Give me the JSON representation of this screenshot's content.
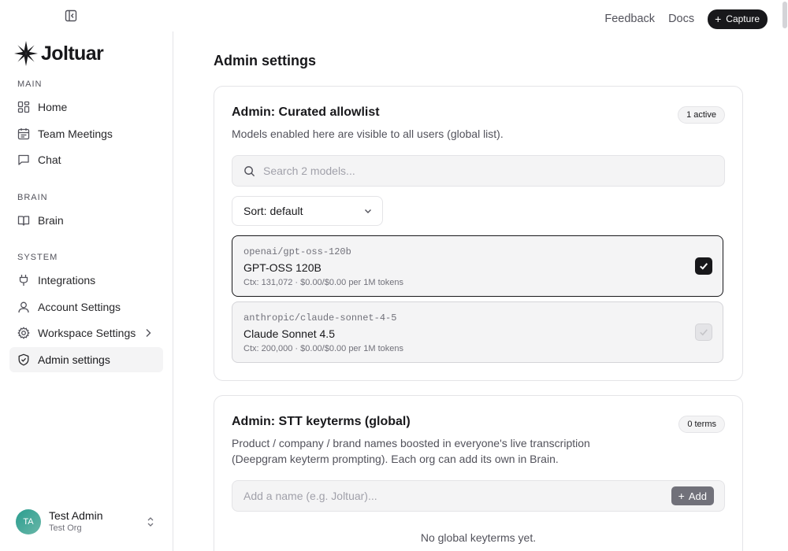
{
  "topbar": {
    "feedback": "Feedback",
    "docs": "Docs",
    "capture": "Capture"
  },
  "brand": {
    "name": "Joltuar"
  },
  "sidebar": {
    "sections": {
      "main": "MAIN",
      "brain": "BRAIN",
      "system": "SYSTEM"
    },
    "items": [
      {
        "label": "Home",
        "icon": "grid-icon"
      },
      {
        "label": "Team Meetings",
        "icon": "calendar-icon"
      },
      {
        "label": "Chat",
        "icon": "chat-bubble-icon"
      },
      {
        "label": "Brain",
        "icon": "book-icon"
      },
      {
        "label": "Integrations",
        "icon": "plug-icon"
      },
      {
        "label": "Account Settings",
        "icon": "user-icon"
      },
      {
        "label": "Workspace Settings",
        "icon": "gear-icon"
      },
      {
        "label": "Admin settings",
        "icon": "shield-check-icon"
      }
    ],
    "active": "Admin settings"
  },
  "user": {
    "initials": "TA",
    "name": "Test Admin",
    "org": "Test Org"
  },
  "page": {
    "title": "Admin settings"
  },
  "allowlist": {
    "title": "Admin: Curated allowlist",
    "badge": "1 active",
    "description": "Models enabled here are visible to all users (global list).",
    "search_placeholder": "Search 2 models...",
    "sort_label": "Sort: default",
    "models": [
      {
        "id": "openai/gpt-oss-120b",
        "name": "GPT-OSS 120B",
        "meta": "Ctx: 131,072 · $0.00/$0.00 per 1M tokens",
        "enabled": true
      },
      {
        "id": "anthropic/claude-sonnet-4-5",
        "name": "Claude Sonnet 4.5",
        "meta": "Ctx: 200,000 · $0.00/$0.00 per 1M tokens",
        "enabled": false
      }
    ]
  },
  "keyterms": {
    "title": "Admin: STT keyterms (global)",
    "badge": "0 terms",
    "description_line1": "Product / company / brand names boosted in everyone's live transcription",
    "description_line2": "(Deepgram keyterm prompting). Each org can add its own in Brain.",
    "input_placeholder": "Add a name (e.g. Joltuar)...",
    "add_label": "Add",
    "empty_text": "No global keyterms yet."
  },
  "colors": {
    "primary": "#18181b",
    "muted": "#f4f4f5",
    "border": "#e4e4e7",
    "avatar": "#2a9d8f"
  }
}
